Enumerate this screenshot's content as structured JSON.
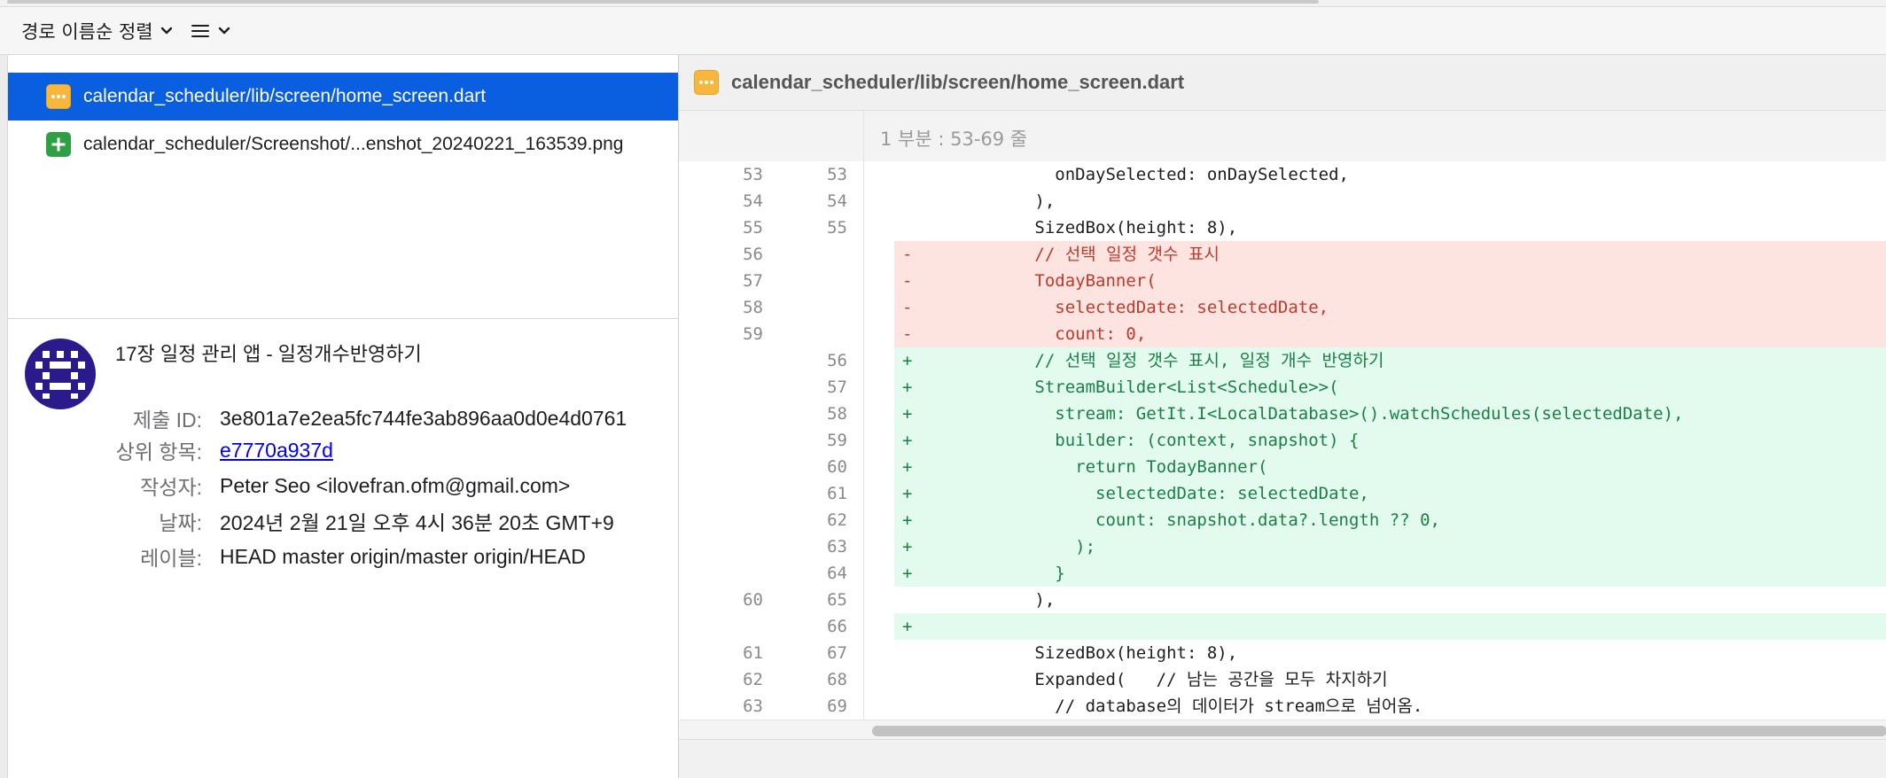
{
  "toolbar": {
    "sort_label": "경로 이름순 정렬"
  },
  "file_list": [
    {
      "status": "modified",
      "path": "calendar_scheduler/lib/screen/home_screen.dart",
      "selected": true
    },
    {
      "status": "added",
      "path": "calendar_scheduler/Screenshot/...enshot_20240221_163539.png",
      "selected": false
    }
  ],
  "commit": {
    "subject": "17장 일정 관리 앱 - 일정개수반영하기",
    "fields": [
      {
        "label": "제출 ID:",
        "value": "3e801a7e2ea5fc744fe3ab896aa0d0e4d0761",
        "link": false
      },
      {
        "label": "상위 항목:",
        "value": "e7770a937d",
        "link": true
      },
      {
        "label": "작성자:",
        "value": "Peter Seo <ilovefran.ofm@gmail.com>",
        "link": false
      },
      {
        "label": "날짜:",
        "value": "2024년 2월 21일 오후 4시 36분 20초 GMT+9",
        "link": false
      },
      {
        "label": "레이블:",
        "value": "HEAD master origin/master origin/HEAD",
        "link": false
      }
    ]
  },
  "diff": {
    "file_title": "calendar_scheduler/lib/screen/home_screen.dart",
    "hunk_title": "1 부분 : 53-69 줄",
    "lines": [
      {
        "type": "ctx",
        "old": "53",
        "new": "53",
        "sign": "",
        "text": "            onDaySelected: onDaySelected,"
      },
      {
        "type": "ctx",
        "old": "54",
        "new": "54",
        "sign": "",
        "text": "          ),"
      },
      {
        "type": "ctx",
        "old": "55",
        "new": "55",
        "sign": "",
        "text": "          SizedBox(height: 8),"
      },
      {
        "type": "del",
        "old": "56",
        "new": "",
        "sign": "-",
        "text": "          // 선택 일정 갯수 표시"
      },
      {
        "type": "del",
        "old": "57",
        "new": "",
        "sign": "-",
        "text": "          TodayBanner("
      },
      {
        "type": "del",
        "old": "58",
        "new": "",
        "sign": "-",
        "text": "            selectedDate: selectedDate,"
      },
      {
        "type": "del",
        "old": "59",
        "new": "",
        "sign": "-",
        "text": "            count: 0,"
      },
      {
        "type": "add",
        "old": "",
        "new": "56",
        "sign": "+",
        "text": "          // 선택 일정 갯수 표시, 일정 개수 반영하기"
      },
      {
        "type": "add",
        "old": "",
        "new": "57",
        "sign": "+",
        "text": "          StreamBuilder<List<Schedule>>("
      },
      {
        "type": "add",
        "old": "",
        "new": "58",
        "sign": "+",
        "text": "            stream: GetIt.I<LocalDatabase>().watchSchedules(selectedDate),"
      },
      {
        "type": "add",
        "old": "",
        "new": "59",
        "sign": "+",
        "text": "            builder: (context, snapshot) {"
      },
      {
        "type": "add",
        "old": "",
        "new": "60",
        "sign": "+",
        "text": "              return TodayBanner("
      },
      {
        "type": "add",
        "old": "",
        "new": "61",
        "sign": "+",
        "text": "                selectedDate: selectedDate,"
      },
      {
        "type": "add",
        "old": "",
        "new": "62",
        "sign": "+",
        "text": "                count: snapshot.data?.length ?? 0,"
      },
      {
        "type": "add",
        "old": "",
        "new": "63",
        "sign": "+",
        "text": "              );"
      },
      {
        "type": "add",
        "old": "",
        "new": "64",
        "sign": "+",
        "text": "            }"
      },
      {
        "type": "ctx",
        "old": "60",
        "new": "65",
        "sign": "",
        "text": "          ),"
      },
      {
        "type": "add",
        "old": "",
        "new": "66",
        "sign": "+",
        "text": ""
      },
      {
        "type": "ctx",
        "old": "61",
        "new": "67",
        "sign": "",
        "text": "          SizedBox(height: 8),"
      },
      {
        "type": "ctx",
        "old": "62",
        "new": "68",
        "sign": "",
        "text": "          Expanded(   // 남는 공간을 모두 차지하기"
      },
      {
        "type": "ctx",
        "old": "63",
        "new": "69",
        "sign": "",
        "text": "            // database의 데이터가 stream으로 넘어옴."
      }
    ]
  },
  "colors": {
    "selection": "#0a5ee0",
    "modified_badge": "#f6b73c",
    "added_badge": "#2ea043",
    "deleted_bg": "#fde4e1",
    "added_bg": "#e3faee",
    "avatar": "#2a1a8c"
  },
  "icons": {
    "sort_chevron": "chevron-down-icon",
    "view_menu": "list-icon",
    "modified": "ellipsis-icon",
    "added": "plus-icon"
  }
}
